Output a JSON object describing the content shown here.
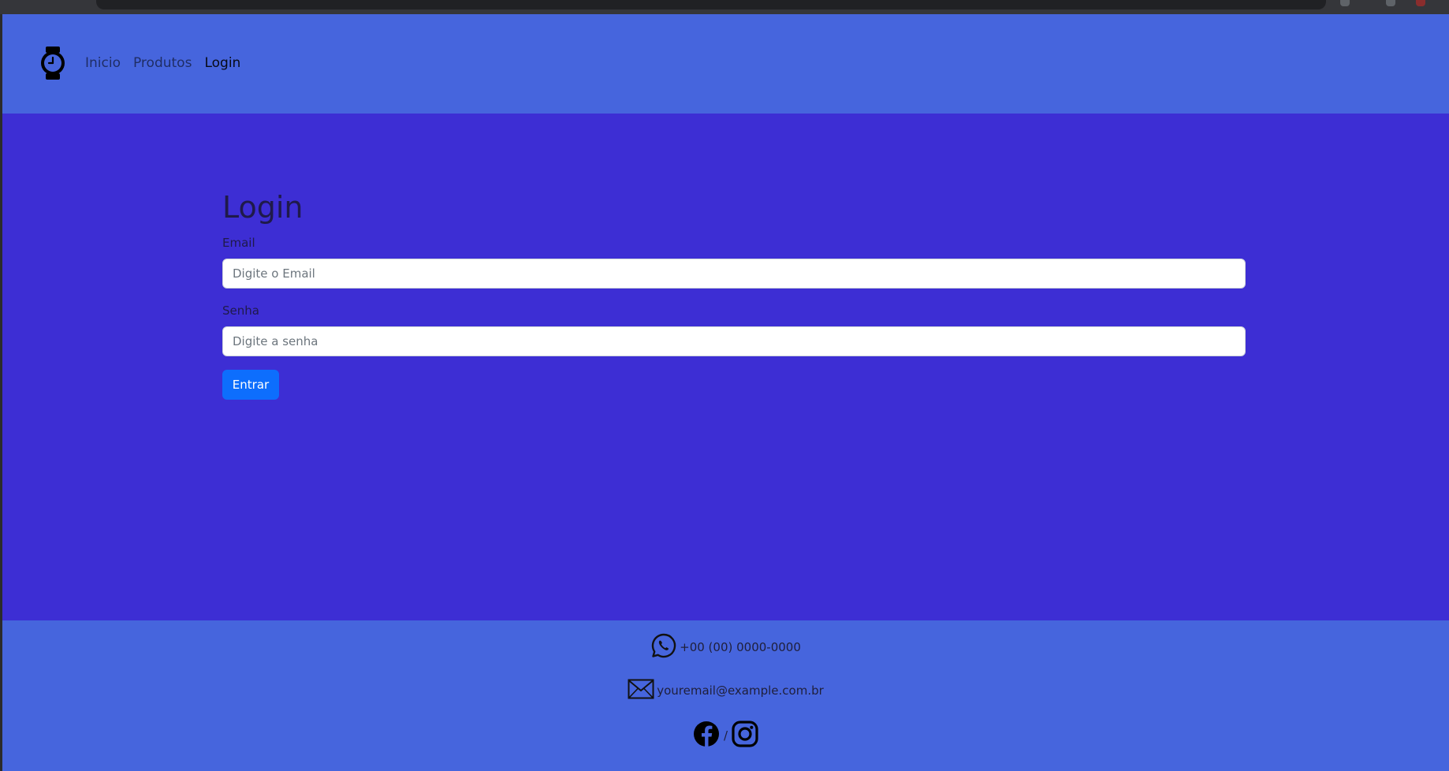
{
  "nav": {
    "brand_icon": "watch-icon",
    "links": [
      {
        "label": "Inicio",
        "active": false
      },
      {
        "label": "Produtos",
        "active": false
      },
      {
        "label": "Login",
        "active": true
      }
    ]
  },
  "login": {
    "title": "Login",
    "email_label": "Email",
    "email_placeholder": "Digite o Email",
    "password_label": "Senha",
    "password_placeholder": "Digite a senha",
    "submit_label": "Entrar"
  },
  "footer": {
    "phone_icon": "whatsapp-icon",
    "phone": "+00 (00) 0000-0000",
    "email_icon": "envelope-icon",
    "email": "youremail@example.com.br",
    "social_icons": [
      "facebook-icon",
      "instagram-icon"
    ],
    "social_separator": "/"
  },
  "colors": {
    "navbar_bg": "#4665dd",
    "main_bg": "#3d2ed4",
    "footer_bg": "#4665dd",
    "button_bg": "#0d6efd"
  }
}
